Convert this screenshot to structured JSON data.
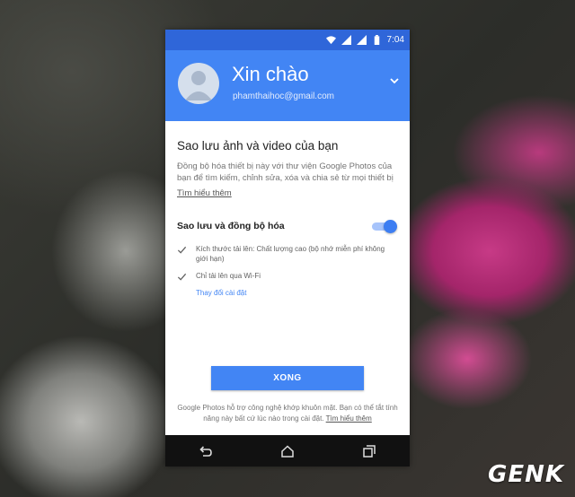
{
  "status_bar": {
    "time": "7:04"
  },
  "account": {
    "greeting": "Xin chào",
    "email": "phamthaihoc@gmail.com"
  },
  "backup": {
    "title": "Sao lưu ảnh và video của bạn",
    "description": "Đồng bộ hóa thiết bị này với thư viện Google Photos của bạn để tìm kiếm, chỉnh sửa, xóa và chia sẻ từ mọi thiết bị",
    "learn_more": "Tìm hiểu thêm",
    "toggle_label": "Sao lưu và đồng bộ hóa",
    "toggle_on": true,
    "options": [
      "Kích thước tải lên: Chất lượng cao (bộ nhớ miễn phí không giới hạn)",
      "Chỉ tải lên qua Wi-Fi"
    ],
    "change_settings": "Thay đổi cài đặt"
  },
  "done_button": "XONG",
  "footer": {
    "text": "Google Photos hỗ trợ công nghệ khớp khuôn mặt. Bạn có thể tắt tính năng này bất cứ lúc nào trong cài đặt.",
    "link": "Tìm hiểu thêm"
  },
  "watermark": "GENK",
  "colors": {
    "header_blue": "#4285f4",
    "status_blue": "#2f66d9",
    "accent": "#4285f4"
  },
  "icons": [
    "wifi-icon",
    "signal-icon",
    "battery-icon",
    "avatar-icon",
    "chevron-down-icon",
    "check-icon",
    "back-icon",
    "home-icon",
    "recents-icon"
  ]
}
